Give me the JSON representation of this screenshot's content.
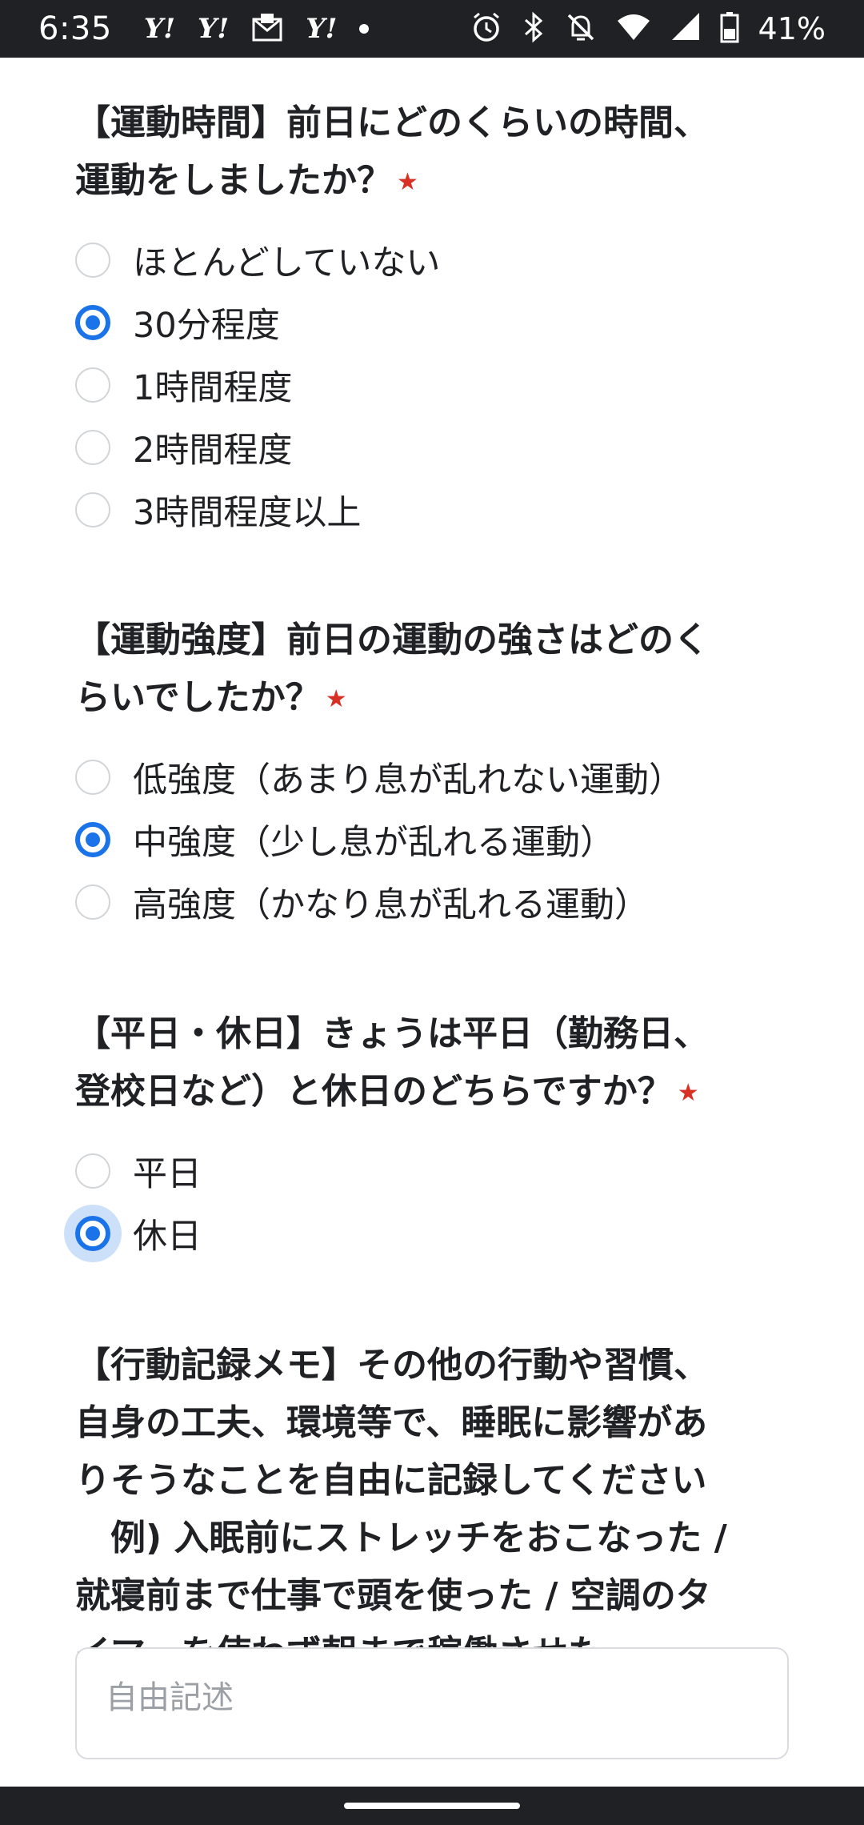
{
  "status_bar": {
    "time": "6:35",
    "notification_icons": [
      "yahoo-icon",
      "yahoo-icon",
      "mail-icon",
      "yahoo-icon",
      "dot-icon"
    ],
    "yahoo_glyph": "Y!",
    "battery_percent": "41%"
  },
  "questions": [
    {
      "title": "【運動時間】前日にどのくらいの時間、\n運動をしましたか？",
      "required_mark": "★",
      "options": [
        {
          "label": "ほとんどしていない",
          "checked": false
        },
        {
          "label": "30分程度",
          "checked": true
        },
        {
          "label": "1時間程度",
          "checked": false
        },
        {
          "label": "2時間程度",
          "checked": false
        },
        {
          "label": "3時間程度以上",
          "checked": false
        }
      ]
    },
    {
      "title": "【運動強度】前日の運動の強さはどのく\nらいでしたか？",
      "required_mark": "★",
      "options": [
        {
          "label": "低強度（あまり息が乱れない運動）",
          "checked": false
        },
        {
          "label": "中強度（少し息が乱れる運動）",
          "checked": true
        },
        {
          "label": "高強度（かなり息が乱れる運動）",
          "checked": false
        }
      ]
    },
    {
      "title": "【平日・休日】きょうは平日（勤務日、\n登校日など）と休日のどちらですか？",
      "required_mark": "★",
      "options": [
        {
          "label": "平日",
          "checked": false
        },
        {
          "label": "休日",
          "checked": true
        }
      ]
    }
  ],
  "memo": {
    "title": "【行動記録メモ】その他の行動や習慣、\n自身の工夫、環境等で、睡眠に影響があ\nりそうなことを自由に記録してください\n　例) 入眠前にストレッチをおこなった /\n就寝前まで仕事で頭を使った / 空調のタ\nイマーを使わず朝まで稼働させた",
    "placeholder": "自由記述"
  },
  "colors": {
    "accent": "#1a73e8",
    "required": "#d93025",
    "status_bar_bg": "#202124"
  }
}
